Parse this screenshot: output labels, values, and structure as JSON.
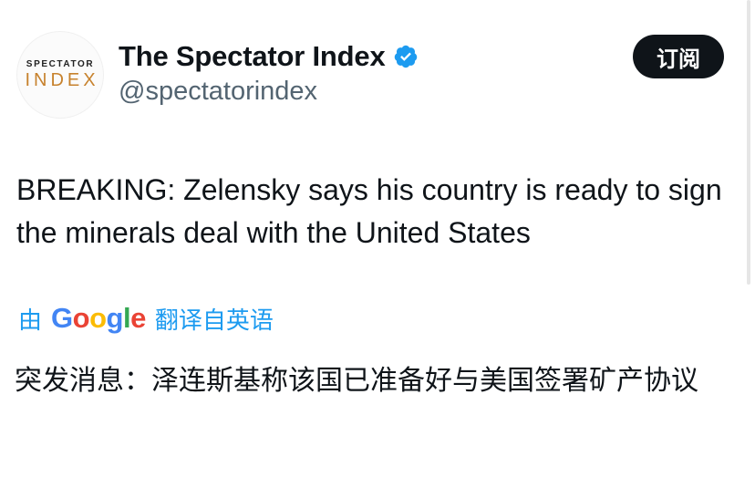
{
  "author": {
    "avatar_top_text": "SPECTATOR",
    "avatar_bottom_text": "INDEX",
    "display_name": "The Spectator Index",
    "handle": "@spectatorindex",
    "verified_icon": "verified-badge-icon"
  },
  "actions": {
    "subscribe_label": "订阅"
  },
  "tweet": {
    "text": "BREAKING: Zelensky says his country is ready to sign the minerals deal with the United States"
  },
  "translation": {
    "prefix": "由",
    "google_letters": [
      "G",
      "o",
      "o",
      "g",
      "l",
      "e"
    ],
    "suffix": "翻译自英语",
    "translated_text": "突发消息：泽连斯基称该国已准备好与美国签署矿产协议"
  },
  "colors": {
    "link_blue": "#1d9bf0",
    "verified_blue": "#1d9bf0",
    "button_dark": "#0f1419",
    "handle_gray": "#536471",
    "index_gold": "#c7822d"
  }
}
